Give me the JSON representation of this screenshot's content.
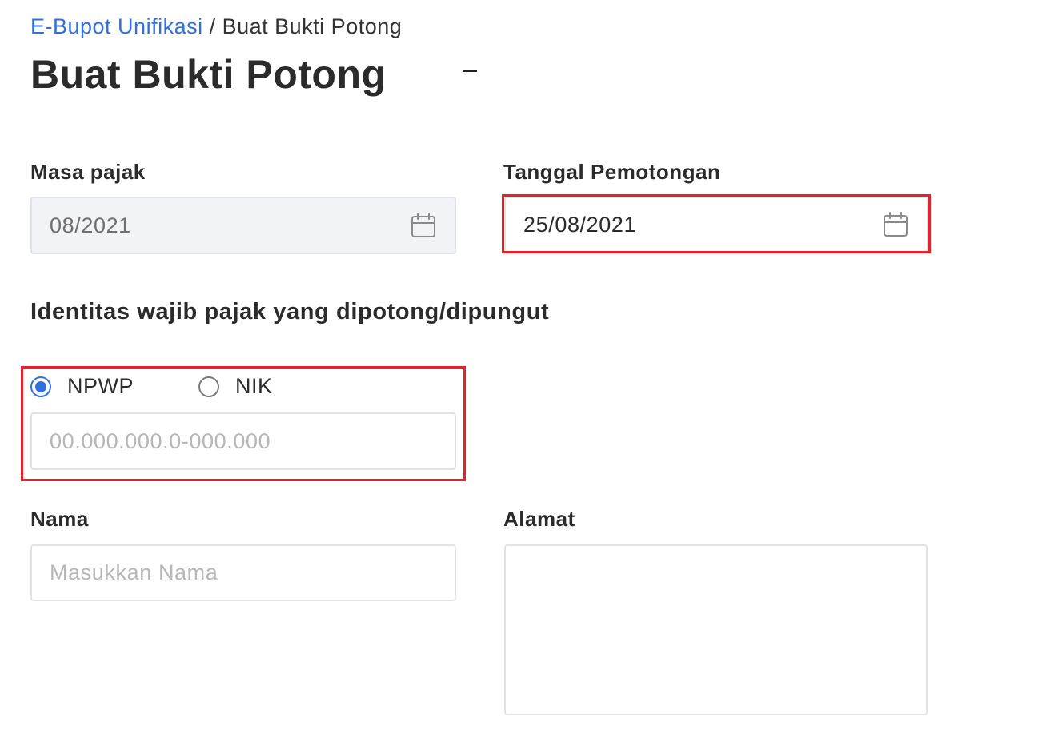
{
  "breadcrumb": {
    "parent": "E-Bupot Unifikasi",
    "separator": "/",
    "current": "Buat Bukti Potong"
  },
  "page": {
    "title": "Buat Bukti Potong"
  },
  "form": {
    "masa_pajak": {
      "label": "Masa pajak",
      "value": "08/2021",
      "icon": "calendar-icon"
    },
    "tanggal_pemotongan": {
      "label": "Tanggal Pemotongan",
      "value": "25/08/2021",
      "icon": "calendar-icon"
    },
    "identitas": {
      "title": "Identitas wajib pajak yang dipotong/dipungut",
      "options": [
        {
          "label": "NPWP",
          "selected": true
        },
        {
          "label": "NIK",
          "selected": false
        }
      ],
      "id_placeholder": "00.000.000.0-000.000"
    },
    "nama": {
      "label": "Nama",
      "placeholder": "Masukkan Nama"
    },
    "alamat": {
      "label": "Alamat",
      "value": ""
    }
  },
  "colors": {
    "link": "#2f6fde",
    "highlight": "#e8202a",
    "radio_selected": "#2f6fde"
  }
}
